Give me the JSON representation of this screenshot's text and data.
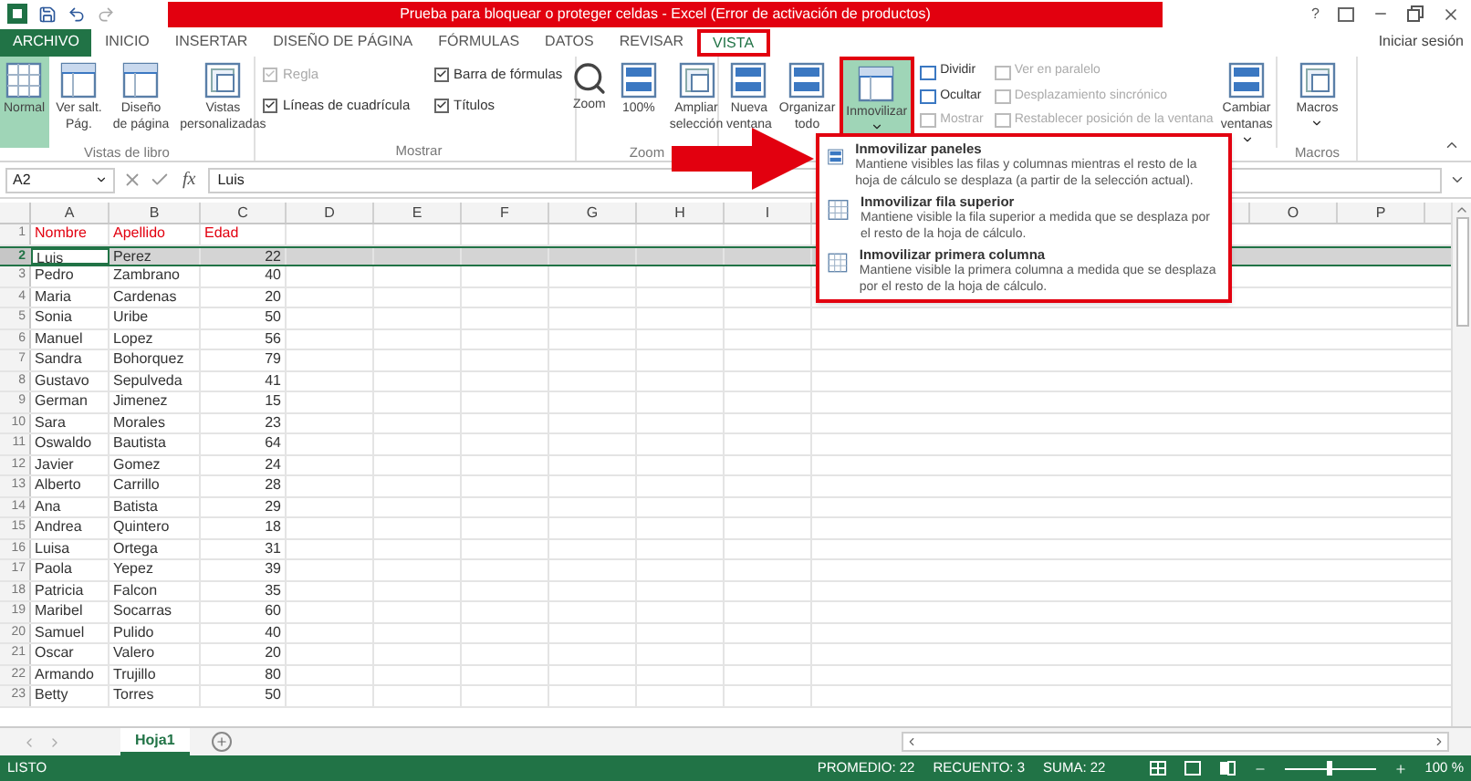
{
  "window": {
    "title": "Prueba para bloquear o proteger celdas - Excel (Error de activación de productos)",
    "help": "?",
    "account": "Iniciar sesión"
  },
  "tabs": [
    {
      "label": "ARCHIVO",
      "kind": "file",
      "selected": false
    },
    {
      "label": "INICIO",
      "kind": "tab",
      "selected": false
    },
    {
      "label": "INSERTAR",
      "kind": "tab",
      "selected": false
    },
    {
      "label": "DISEÑO DE PÁGINA",
      "kind": "tab",
      "selected": false
    },
    {
      "label": "FÓRMULAS",
      "kind": "tab",
      "selected": false
    },
    {
      "label": "DATOS",
      "kind": "tab",
      "selected": false
    },
    {
      "label": "REVISAR",
      "kind": "tab",
      "selected": false
    },
    {
      "label": "VISTA",
      "kind": "tab",
      "selected": true
    }
  ],
  "ribbon": {
    "vistas": {
      "label": "Vistas de libro",
      "buttons": [
        {
          "label": "Normal",
          "selected": true
        },
        {
          "label": "Ver salt.\nPág.",
          "selected": false
        },
        {
          "label": "Diseño\nde página",
          "selected": false
        },
        {
          "label": "Vistas\npersonalizadas",
          "selected": false
        }
      ]
    },
    "mostrar": {
      "label": "Mostrar",
      "checks": [
        {
          "label": "Regla",
          "checked": true,
          "disabled": true
        },
        {
          "label": "Líneas de cuadrícula",
          "checked": true,
          "disabled": false
        },
        {
          "label": "Barra de fórmulas",
          "checked": true,
          "disabled": false
        },
        {
          "label": "Títulos",
          "checked": true,
          "disabled": false
        }
      ]
    },
    "zoom": {
      "label": "Zoom",
      "buttons": [
        {
          "label": "Zoom"
        },
        {
          "label": "100%"
        },
        {
          "label": "Ampliar\nselección"
        }
      ]
    },
    "ventana": {
      "large": [
        {
          "label": "Nueva\nventana",
          "selected": false
        },
        {
          "label": "Organizar\ntodo",
          "selected": false
        },
        {
          "label": "Inmovilizar",
          "selected": true
        }
      ],
      "small": [
        {
          "label": "Dividir",
          "disabled": false
        },
        {
          "label": "Ocultar",
          "disabled": false
        },
        {
          "label": "Mostrar",
          "disabled": true
        },
        {
          "label": "Ver en paralelo",
          "disabled": true
        },
        {
          "label": "Desplazamiento sincrónico",
          "disabled": true
        },
        {
          "label": "Restablecer posición de la ventana",
          "disabled": true
        }
      ],
      "switch": {
        "label": "Cambiar\nventanas"
      }
    },
    "macros": {
      "label": "Macros",
      "button": "Macros"
    }
  },
  "formula_bar": {
    "cell": "A2",
    "function_label": "fx",
    "value": "Luis"
  },
  "grid": {
    "columns": [
      "A",
      "B",
      "C",
      "D",
      "E",
      "F",
      "G",
      "H",
      "I"
    ],
    "columns_right": [
      "O",
      "P"
    ],
    "rows": [
      {
        "number": "1",
        "kind": "header",
        "selected": false,
        "cells": [
          "Nombre",
          "Apellido",
          "Edad"
        ]
      },
      {
        "number": "2",
        "kind": "data",
        "selected": true,
        "cells": [
          "Luis",
          "Perez",
          "22"
        ]
      },
      {
        "number": "3",
        "kind": "data",
        "selected": false,
        "cells": [
          "Pedro",
          "Zambrano",
          "40"
        ]
      },
      {
        "number": "4",
        "kind": "data",
        "selected": false,
        "cells": [
          "Maria",
          "Cardenas",
          "20"
        ]
      },
      {
        "number": "5",
        "kind": "data",
        "selected": false,
        "cells": [
          "Sonia",
          "Uribe",
          "50"
        ]
      },
      {
        "number": "6",
        "kind": "data",
        "selected": false,
        "cells": [
          "Manuel",
          "Lopez",
          "56"
        ]
      },
      {
        "number": "7",
        "kind": "data",
        "selected": false,
        "cells": [
          "Sandra",
          "Bohorquez",
          "79"
        ]
      },
      {
        "number": "8",
        "kind": "data",
        "selected": false,
        "cells": [
          "Gustavo",
          "Sepulveda",
          "41"
        ]
      },
      {
        "number": "9",
        "kind": "data",
        "selected": false,
        "cells": [
          "German",
          "Jimenez",
          "15"
        ]
      },
      {
        "number": "10",
        "kind": "data",
        "selected": false,
        "cells": [
          "Sara",
          "Morales",
          "23"
        ]
      },
      {
        "number": "11",
        "kind": "data",
        "selected": false,
        "cells": [
          "Oswaldo",
          "Bautista",
          "64"
        ]
      },
      {
        "number": "12",
        "kind": "data",
        "selected": false,
        "cells": [
          "Javier",
          "Gomez",
          "24"
        ]
      },
      {
        "number": "13",
        "kind": "data",
        "selected": false,
        "cells": [
          "Alberto",
          "Carrillo",
          "28"
        ]
      },
      {
        "number": "14",
        "kind": "data",
        "selected": false,
        "cells": [
          "Ana",
          "Batista",
          "29"
        ]
      },
      {
        "number": "15",
        "kind": "data",
        "selected": false,
        "cells": [
          "Andrea",
          "Quintero",
          "18"
        ]
      },
      {
        "number": "16",
        "kind": "data",
        "selected": false,
        "cells": [
          "Luisa",
          "Ortega",
          "31"
        ]
      },
      {
        "number": "17",
        "kind": "data",
        "selected": false,
        "cells": [
          "Paola",
          "Yepez",
          "39"
        ]
      },
      {
        "number": "18",
        "kind": "data",
        "selected": false,
        "cells": [
          "Patricia",
          "Falcon",
          "35"
        ]
      },
      {
        "number": "19",
        "kind": "data",
        "selected": false,
        "cells": [
          "Maribel",
          "Socarras",
          "60"
        ]
      },
      {
        "number": "20",
        "kind": "data",
        "selected": false,
        "cells": [
          "Samuel",
          "Pulido",
          "40"
        ]
      },
      {
        "number": "21",
        "kind": "data",
        "selected": false,
        "cells": [
          "Oscar",
          "Valero",
          "20"
        ]
      },
      {
        "number": "22",
        "kind": "data",
        "selected": false,
        "cells": [
          "Armando",
          "Trujillo",
          "80"
        ]
      },
      {
        "number": "23",
        "kind": "data",
        "selected": false,
        "cells": [
          "Betty",
          "Torres",
          "50"
        ]
      }
    ]
  },
  "freeze_menu": {
    "items": [
      {
        "title": "Inmovilizar paneles",
        "description": "Mantiene visibles las filas y columnas mientras el resto de la hoja de cálculo se desplaza (a partir de la selección actual)."
      },
      {
        "title": "Inmovilizar fila superior",
        "description": "Mantiene visible la fila superior a medida que se desplaza por el resto de la hoja de cálculo."
      },
      {
        "title": "Inmovilizar primera columna",
        "description": "Mantiene visible la primera columna a medida que se desplaza por el resto de la hoja de cálculo."
      }
    ]
  },
  "sheets": [
    {
      "label": "Hoja1",
      "selected": true
    }
  ],
  "status_bar": {
    "state": "LISTO",
    "stats": [
      "PROMEDIO: 22",
      "RECUENTO: 3",
      "SUMA: 22"
    ],
    "zoom": {
      "level": 0.5,
      "reading": "100 %"
    }
  }
}
